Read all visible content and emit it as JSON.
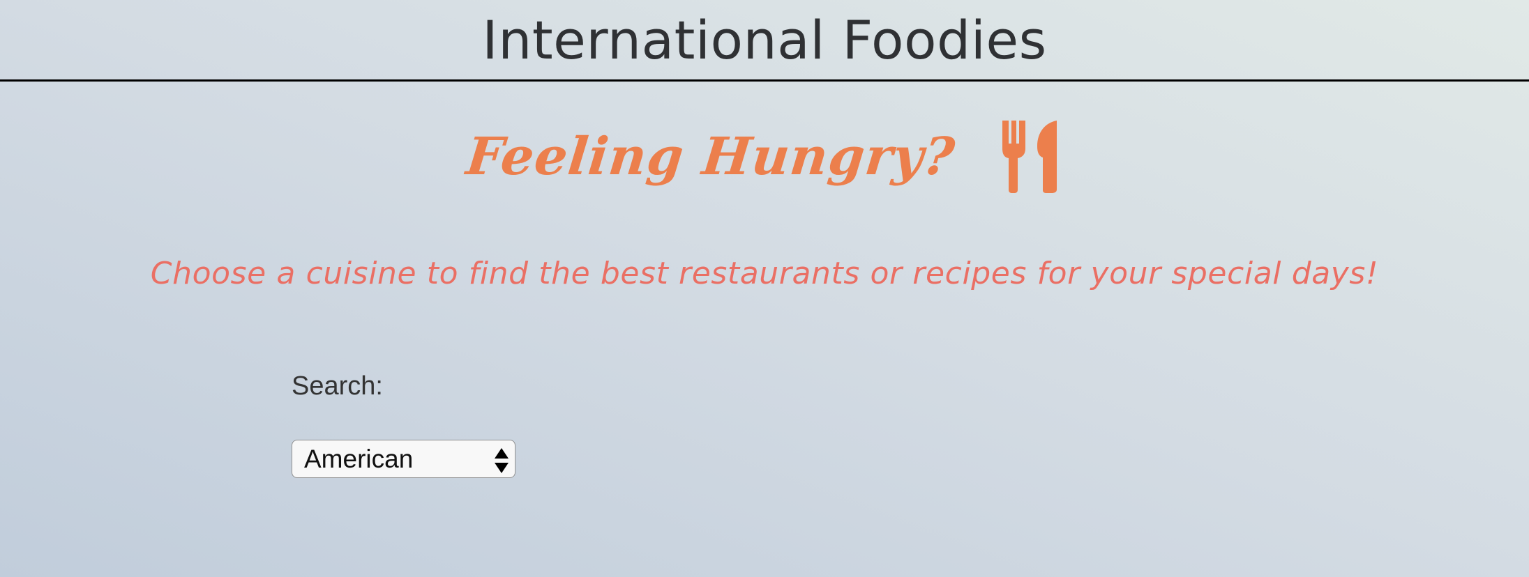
{
  "header": {
    "title": "International Foodies"
  },
  "hero": {
    "title": "Feeling Hungry?",
    "icon": "fork-knife-icon",
    "accent_color": "#ec7f4c"
  },
  "tagline": "Choose a cuisine to find the best restaurants or recipes for your special days!",
  "search": {
    "label": "Search:",
    "selected": "American"
  },
  "colors": {
    "tagline": "#ea6f64",
    "header_rule": "#000000"
  }
}
